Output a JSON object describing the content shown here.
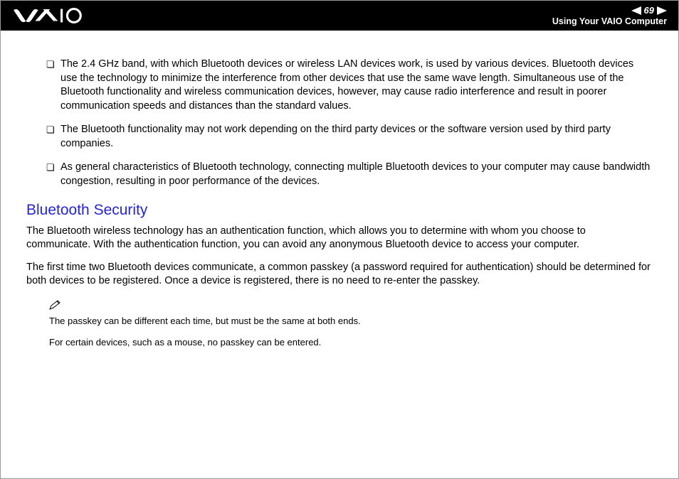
{
  "header": {
    "page_number": "69",
    "subtitle": "Using Your VAIO Computer"
  },
  "bullets": [
    "The 2.4 GHz band, with which Bluetooth devices or wireless LAN devices work, is used by various devices. Bluetooth devices use the technology to minimize the interference from other devices that use the same wave length. Simultaneous use of the Bluetooth functionality and wireless communication devices, however, may cause radio interference and result in poorer communication speeds and distances than the standard values.",
    "The Bluetooth functionality may not work depending on the third party devices or the software version used by third party companies.",
    "As general characteristics of Bluetooth technology, connecting multiple Bluetooth devices to your computer may cause bandwidth congestion, resulting in poor performance of the devices."
  ],
  "section": {
    "heading": "Bluetooth Security",
    "para1": "The Bluetooth wireless technology has an authentication function, which allows you to determine with whom you choose to communicate. With the authentication function, you can avoid any anonymous Bluetooth device to access your computer.",
    "para2": "The first time two Bluetooth devices communicate, a common passkey (a password required for authentication) should be determined for both devices to be registered. Once a device is registered, there is no need to re-enter the passkey."
  },
  "notes": {
    "line1": "The passkey can be different each time, but must be the same at both ends.",
    "line2": "For certain devices, such as a mouse, no passkey can be entered."
  }
}
